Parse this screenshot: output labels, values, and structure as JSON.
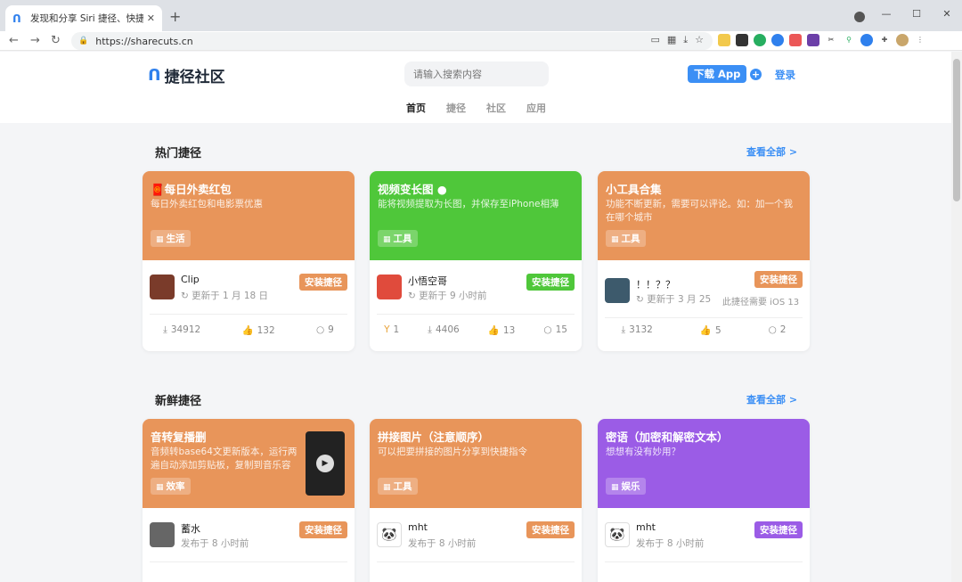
{
  "browser": {
    "tab_title": "发现和分享 Siri 捷径、快捷指令",
    "url": "https://sharecuts.cn"
  },
  "header": {
    "logo_text": "捷径社区",
    "search_placeholder": "请输入搜索内容",
    "download_label": "下载 App",
    "login_label": "登录",
    "nav": [
      "首页",
      "捷径",
      "社区",
      "应用"
    ]
  },
  "sections": {
    "hot": {
      "title": "热门捷径",
      "view_all": "查看全部 >"
    },
    "fresh": {
      "title": "新鲜捷径",
      "view_all": "查看全部 >"
    }
  },
  "hot_cards": [
    {
      "title": "🧧每日外卖红包",
      "desc": "每日外卖红包和电影票优惠",
      "tag": "生活",
      "author": "Clip",
      "updated": "更新于 1 月 18 日",
      "install": "安装捷径",
      "stats": [
        "34912",
        "132",
        "9"
      ],
      "color": "#e8955a"
    },
    {
      "title": "视频变长图",
      "desc": "能将视频提取为长图，并保存至iPhone相薄",
      "tag": "工具",
      "author": "小悟空哥",
      "updated": "更新于 9 小时前",
      "install": "安装捷径",
      "stats": [
        "1",
        "4406",
        "13",
        "15"
      ],
      "color": "#4fc73a"
    },
    {
      "title": "小工具合集",
      "desc": "功能不断更新，需要可以评论。如：加一个我在哪个城市",
      "tag": "工具",
      "author": "！！？？",
      "updated": "更新于 3 月 25",
      "note": "此捷径需要 iOS 13",
      "install": "安装捷径",
      "stats": [
        "3132",
        "5",
        "2"
      ],
      "color": "#e8955a"
    }
  ],
  "fresh_cards": [
    {
      "title": "音转复播删",
      "desc": "音频转base64文更新版本，运行两遍自动添加剪贴板，复制到音乐容",
      "tag": "效率",
      "author": "蓄水",
      "updated": "发布于 8 小时前",
      "install": "安装捷径",
      "color": "#e8955a"
    },
    {
      "title": "拼接图片（注意顺序）",
      "desc": "可以把要拼接的图片分享到快捷指令",
      "tag": "工具",
      "author": "mht",
      "updated": "发布于 8 小时前",
      "install": "安装捷径",
      "color": "#e8955a"
    },
    {
      "title": "密语（加密和解密文本）",
      "desc": "想想有没有妙用？",
      "tag": "娱乐",
      "author": "mht",
      "updated": "发布于 8 小时前",
      "install": "安装捷径",
      "color": "#9b5ce6"
    }
  ]
}
